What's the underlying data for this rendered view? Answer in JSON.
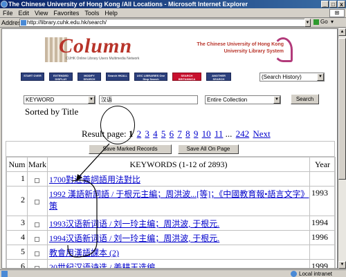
{
  "window": {
    "title": "The Chinese University of Hong Kong /All Locations - Microsoft Internet Explorer",
    "buttons": [
      "_",
      "□",
      "x"
    ]
  },
  "menubar": {
    "items": [
      "File",
      "Edit",
      "View",
      "Favorites",
      "Tools",
      "Help"
    ]
  },
  "addressbar": {
    "label": "Address",
    "url": "http://library.cuhk.edu.hk/search/",
    "go": "Go",
    "links": "▾"
  },
  "banner": {
    "logo_word": "Column",
    "logo_subtitle": "CUHK Online Library Users Multimedia Network",
    "lib_title_line1": "The Chinese University of Hong Kong",
    "lib_title_line2": "University Library System"
  },
  "nav_buttons": [
    {
      "label": "START OVER"
    },
    {
      "label": "EXTENDED DISPLAY"
    },
    {
      "label": "MODIFY SEARCH"
    },
    {
      "label": "Search HKALL"
    },
    {
      "label": "UGC LIBRARIES One Stop Search"
    },
    {
      "label": "SEARCH BRITANNICA"
    },
    {
      "label": "ANOTHER SEARCH"
    }
  ],
  "search_history": "(Search History)",
  "search": {
    "field": "KEYWORD",
    "term": "汉语",
    "collection": "Entire Collection",
    "button": "Search"
  },
  "sorted_by": "Sorted by Title",
  "pagination": {
    "label": "Result page:",
    "current": "1",
    "pages": [
      "2",
      "3",
      "4",
      "5",
      "6",
      "7",
      "8",
      "9",
      "10",
      "11"
    ],
    "ellipsis": "...",
    "last": "242",
    "next": "Next"
  },
  "results": {
    "save_marked": "Save Marked Records",
    "save_all": "Save All On Page",
    "headers": {
      "num": "Num",
      "mark": "Mark",
      "keywords": "KEYWORDS (1-12 of 2893)",
      "year": "Year"
    },
    "rows": [
      {
        "num": "1",
        "title": "1700對近義詞語用法對比",
        "year": ""
      },
      {
        "num": "2",
        "title": "1992 漢語新詞語 / 于根元主編；周洪波...[等]；《中國教育報•語言文字》策",
        "year": "1993"
      },
      {
        "num": "3",
        "title": "1993汉语新词语 / 刘一玲主编；周洪波, 于根元.",
        "year": "1994"
      },
      {
        "num": "4",
        "title": "1994汉语新词语 / 刘一玲主编；周洪波, 于根元.",
        "year": "1996"
      },
      {
        "num": "5",
        "title": "教會用漢語課本 (2)",
        "year": ""
      },
      {
        "num": "6",
        "title": "20世纪汉语诗选 / 姜耕玉选编",
        "year": "1999"
      }
    ]
  },
  "statusbar": {
    "zone": "Local intranet"
  }
}
